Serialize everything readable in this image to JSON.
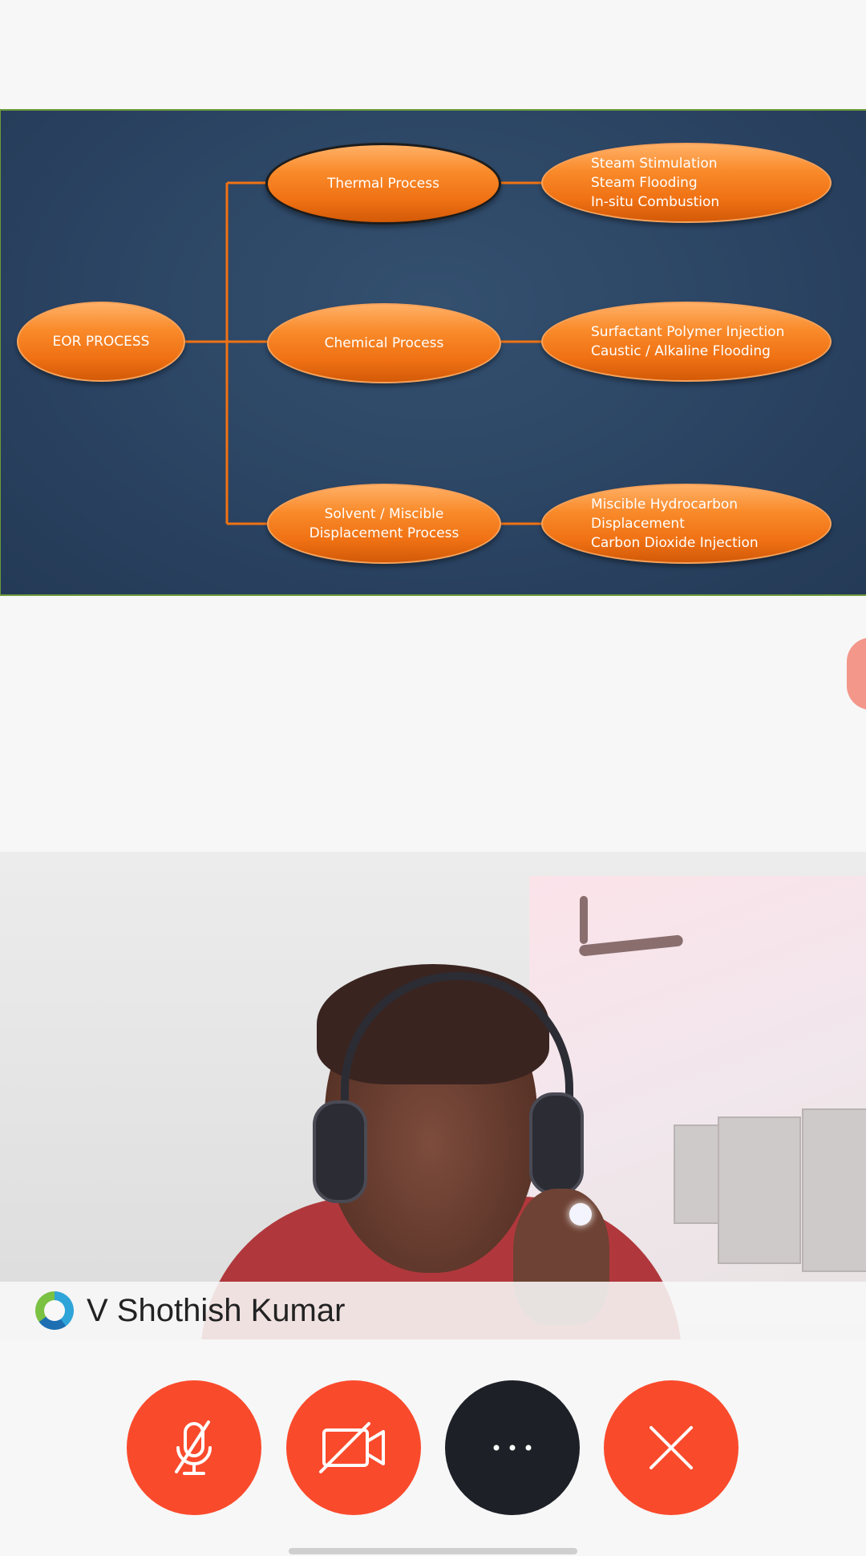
{
  "slide": {
    "root": "EOR PROCESS",
    "processes": [
      {
        "label": "Thermal Process",
        "methods": "Steam Stimulation\nSteam Flooding\nIn-situ Combustion"
      },
      {
        "label": "Chemical Process",
        "methods": "Surfactant Polymer Injection\nCaustic / Alkaline Flooding"
      },
      {
        "label": "Solvent / Miscible\nDisplacement Process",
        "methods": "Miscible Hydrocarbon\nDisplacement\nCarbon Dioxide Injection"
      }
    ],
    "colors": {
      "node": "#f07214",
      "background": "#2b4463",
      "connector": "#f07214"
    }
  },
  "participant": {
    "name": "V Shothish Kumar",
    "presence_icon": "webex-presence-icon"
  },
  "controls": {
    "mute_icon": "microphone-muted-icon",
    "video_icon": "camera-off-icon",
    "more_icon": "more-dots-icon",
    "leave_icon": "close-icon",
    "accent_color": "#fa4a2c",
    "more_color": "#1d2127"
  }
}
